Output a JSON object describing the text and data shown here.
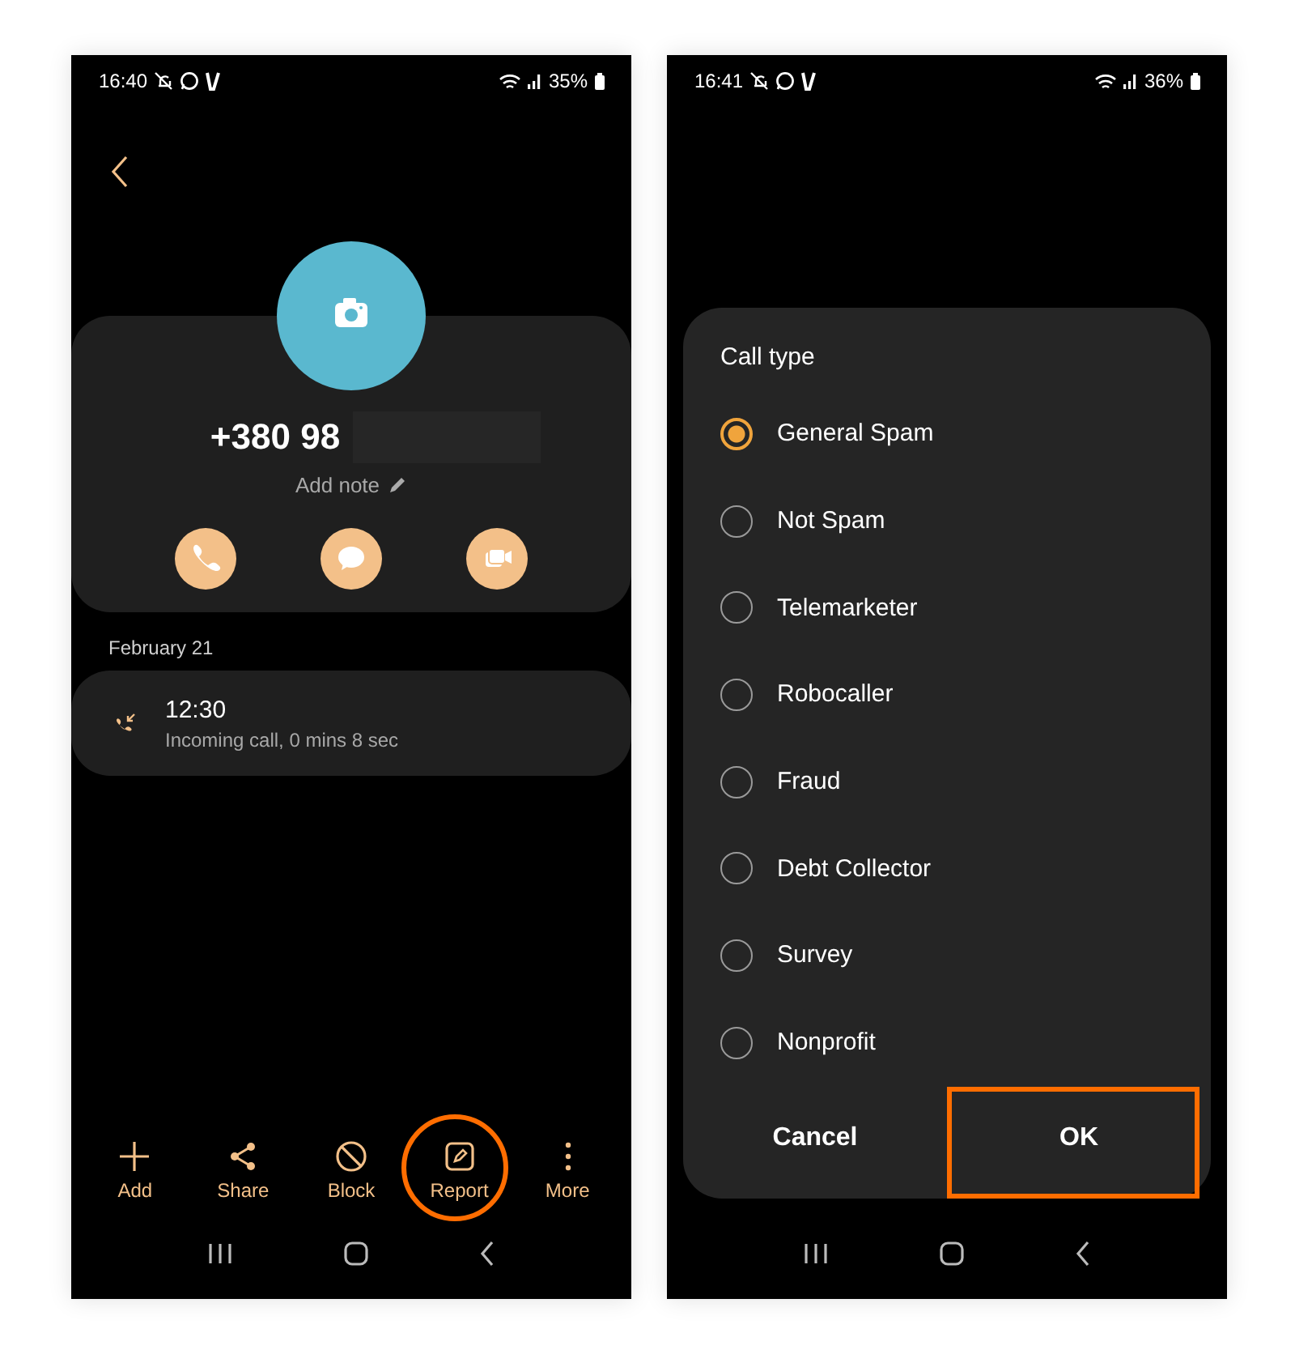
{
  "screens": [
    {
      "kind": "contact",
      "status_bar": {
        "time": "16:40",
        "battery": "35%"
      },
      "contact": {
        "number": "+380 98",
        "note_label": "Add note"
      },
      "history": {
        "date": "February 21",
        "calls": [
          {
            "time": "12:30",
            "detail": "Incoming call, 0 mins 8 sec"
          }
        ]
      },
      "toolbar": [
        {
          "label": "Add",
          "highlighted": false
        },
        {
          "label": "Share",
          "highlighted": false
        },
        {
          "label": "Block",
          "highlighted": false
        },
        {
          "label": "Report",
          "highlighted": true
        },
        {
          "label": "More",
          "highlighted": false
        }
      ]
    },
    {
      "kind": "dialog",
      "status_bar": {
        "time": "16:41",
        "battery": "36%"
      },
      "dialog": {
        "title": "Call type",
        "options": [
          {
            "label": "General Spam",
            "selected": true
          },
          {
            "label": "Not Spam",
            "selected": false
          },
          {
            "label": "Telemarketer",
            "selected": false
          },
          {
            "label": "Robocaller",
            "selected": false
          },
          {
            "label": "Fraud",
            "selected": false
          },
          {
            "label": "Debt Collector",
            "selected": false
          },
          {
            "label": "Survey",
            "selected": false
          },
          {
            "label": "Nonprofit",
            "selected": false
          }
        ],
        "buttons": [
          {
            "label": "Cancel",
            "highlighted": false
          },
          {
            "label": "OK",
            "highlighted": true
          }
        ]
      }
    }
  ]
}
